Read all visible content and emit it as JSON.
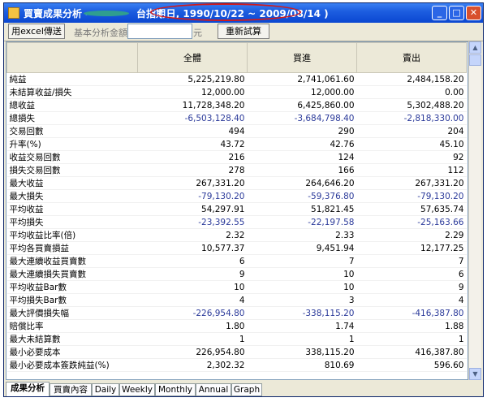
{
  "window": {
    "title": "買賣成果分析 -",
    "index_label": "台指期",
    "range_label": "( 日, 1990/10/22 ~ 2009/08/14 )",
    "btn_min": "_",
    "btn_max": "□",
    "btn_close": "✕"
  },
  "toolbar": {
    "export_label": "用excel傳送",
    "capital_label": "基本分析金額",
    "capital_value": "",
    "unit_label": "元",
    "recalc_label": "重新試算"
  },
  "table": {
    "columns": [
      "",
      "全體",
      "買進",
      "賣出"
    ],
    "rows": [
      {
        "label": "純益",
        "all": "5,225,219.80",
        "buy": "2,741,061.60",
        "sell": "2,484,158.20"
      },
      {
        "label": "未結算收益/損失",
        "all": "12,000.00",
        "buy": "12,000.00",
        "sell": "0.00"
      },
      {
        "label": "總收益",
        "all": "11,728,348.20",
        "buy": "6,425,860.00",
        "sell": "5,302,488.20"
      },
      {
        "label": "總損失",
        "all": "-6,503,128.40",
        "buy": "-3,684,798.40",
        "sell": "-2,818,330.00"
      },
      {
        "label": "交易回數",
        "all": "494",
        "buy": "290",
        "sell": "204"
      },
      {
        "label": "升率(%)",
        "all": "43.72",
        "buy": "42.76",
        "sell": "45.10"
      },
      {
        "label": "收益交易回數",
        "all": "216",
        "buy": "124",
        "sell": "92"
      },
      {
        "label": "損失交易回數",
        "all": "278",
        "buy": "166",
        "sell": "112"
      },
      {
        "label": "最大收益",
        "all": "267,331.20",
        "buy": "264,646.20",
        "sell": "267,331.20"
      },
      {
        "label": "最大損失",
        "all": "-79,130.20",
        "buy": "-59,376.80",
        "sell": "-79,130.20"
      },
      {
        "label": "平均收益",
        "all": "54,297.91",
        "buy": "51,821.45",
        "sell": "57,635.74"
      },
      {
        "label": "平均損失",
        "all": "-23,392.55",
        "buy": "-22,197.58",
        "sell": "-25,163.66"
      },
      {
        "label": "平均收益比率(倍)",
        "all": "2.32",
        "buy": "2.33",
        "sell": "2.29"
      },
      {
        "label": "平均各買賣損益",
        "all": "10,577.37",
        "buy": "9,451.94",
        "sell": "12,177.25"
      },
      {
        "label": "最大連續收益買賣數",
        "all": "6",
        "buy": "7",
        "sell": "7"
      },
      {
        "label": "最大連續損失買賣數",
        "all": "9",
        "buy": "10",
        "sell": "6"
      },
      {
        "label": "平均收益Bar數",
        "all": "10",
        "buy": "10",
        "sell": "9"
      },
      {
        "label": "平均損失Bar數",
        "all": "4",
        "buy": "3",
        "sell": "4"
      },
      {
        "label": "最大評價損失幅",
        "all": "-226,954.80",
        "buy": "-338,115.20",
        "sell": "-416,387.80"
      },
      {
        "label": "賠償比率",
        "all": "1.80",
        "buy": "1.74",
        "sell": "1.88"
      },
      {
        "label": "最大未結算數",
        "all": "1",
        "buy": "1",
        "sell": "1"
      },
      {
        "label": "最小必要成本",
        "all": "226,954.80",
        "buy": "338,115.20",
        "sell": "416,387.80"
      },
      {
        "label": "最小必要成本簽跌純益(%)",
        "all": "2,302.32",
        "buy": "810.69",
        "sell": "596.60"
      }
    ]
  },
  "tabs": [
    "成果分析",
    "買賣內容",
    "Daily",
    "Weekly",
    "Monthly",
    "Annual",
    "Graph"
  ],
  "active_tab": 0,
  "colors": {
    "negative": "#2b3a9a",
    "title_bar": "#1d5ee0",
    "highlight_ellipse": "#d11a1a"
  }
}
